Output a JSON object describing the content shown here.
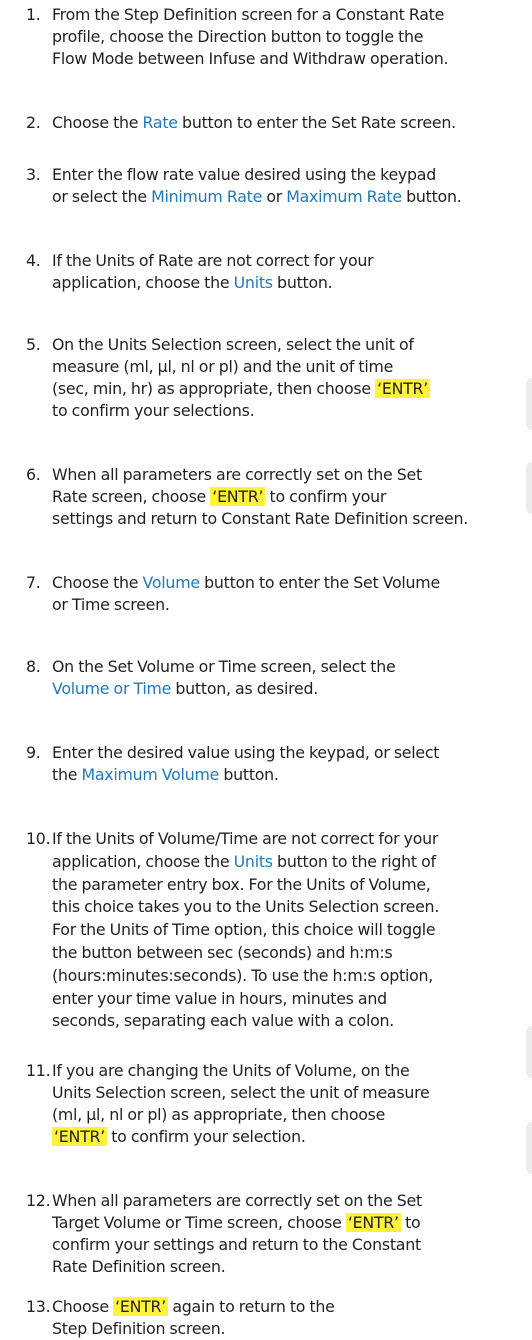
{
  "steps": [
    {
      "n": "1.",
      "lines": [
        [
          [
            "From the Step Definition screen for a Constant Rate",
            ""
          ]
        ],
        [
          [
            "profile, choose the Direction button to toggle the",
            ""
          ]
        ],
        [
          [
            "Flow Mode between Infuse and Withdraw operation.",
            ""
          ]
        ]
      ]
    },
    {
      "n": "2.",
      "lines": [
        [
          [
            "Choose the ",
            ""
          ],
          [
            "Rate",
            "blue"
          ],
          [
            " button to enter the Set Rate screen.",
            ""
          ]
        ]
      ]
    },
    {
      "n": "3.",
      "lines": [
        [
          [
            "Enter the flow rate value desired using the keypad",
            ""
          ]
        ],
        [
          [
            "or select the ",
            ""
          ],
          [
            "Minimum Rate",
            "blue"
          ],
          [
            " or ",
            ""
          ],
          [
            "Maximum Rate",
            "blue"
          ],
          [
            " button.",
            ""
          ]
        ]
      ]
    },
    {
      "n": "4.",
      "lines": [
        [
          [
            "If the Units of Rate are not correct for your",
            ""
          ]
        ],
        [
          [
            "application, choose the ",
            ""
          ],
          [
            "Units",
            "blue"
          ],
          [
            " button.",
            ""
          ]
        ]
      ]
    },
    {
      "n": "5.",
      "lines": [
        [
          [
            "On the Units Selection screen, select the unit of",
            ""
          ]
        ],
        [
          [
            "measure (ml, µl, nl or pl) and the unit of time",
            ""
          ]
        ],
        [
          [
            "(sec, min, hr) as appropriate, then choose ",
            ""
          ],
          [
            "‘ENTR’",
            "key"
          ]
        ],
        [
          [
            "to confirm your selections.",
            ""
          ]
        ]
      ]
    },
    {
      "n": "6.",
      "lines": [
        [
          [
            "When all parameters are correctly set on the Set",
            ""
          ]
        ],
        [
          [
            "Rate screen, choose ",
            ""
          ],
          [
            "‘ENTR’",
            "key"
          ],
          [
            " to confirm your",
            ""
          ]
        ],
        [
          [
            "settings and return to Constant Rate Definition screen.",
            ""
          ]
        ]
      ]
    },
    {
      "n": "7.",
      "lines": [
        [
          [
            "Choose the ",
            ""
          ],
          [
            "Volume",
            "blue"
          ],
          [
            " button to enter the Set Volume",
            ""
          ]
        ],
        [
          [
            "or Time screen.",
            ""
          ]
        ]
      ]
    },
    {
      "n": "8.",
      "lines": [
        [
          [
            "On the Set Volume or Time screen, select the",
            ""
          ]
        ],
        [
          [
            "Volume or Time",
            "blue"
          ],
          [
            " button, as desired.",
            ""
          ]
        ]
      ]
    },
    {
      "n": "9.",
      "lines": [
        [
          [
            "Enter the desired value using the keypad, or select",
            ""
          ]
        ],
        [
          [
            "the ",
            ""
          ],
          [
            "Maximum Volume",
            "blue"
          ],
          [
            " button.",
            ""
          ]
        ]
      ]
    },
    {
      "n": "10.",
      "lines": [
        [
          [
            "If the Units of Volume/Time are not correct for your",
            ""
          ]
        ],
        [
          [
            "application, choose the ",
            ""
          ],
          [
            "Units",
            "blue"
          ],
          [
            " button to the right of",
            ""
          ]
        ],
        [
          [
            "the parameter entry box. For the Units of Volume,",
            ""
          ]
        ],
        [
          [
            "this choice takes you to the Units Selection screen.",
            ""
          ]
        ],
        [
          [
            "For the Units of Time option, this choice will toggle",
            ""
          ]
        ],
        [
          [
            "the button between sec (seconds) and h:m:s",
            ""
          ]
        ],
        [
          [
            "(hours:minutes:seconds). To use the h:m:s option,",
            ""
          ]
        ],
        [
          [
            "enter your time value in hours, minutes and",
            ""
          ]
        ],
        [
          [
            "seconds, separating each value with a colon.",
            ""
          ]
        ]
      ]
    },
    {
      "n": "11.",
      "lines": [
        [
          [
            "If you are changing the Units of Volume, on the",
            ""
          ]
        ],
        [
          [
            "Units Selection screen, select the unit of measure",
            ""
          ]
        ],
        [
          [
            "(ml, µl, nl or pl) as appropriate, then choose",
            ""
          ]
        ],
        [
          [
            "‘ENTR’",
            "key"
          ],
          [
            " to confirm your selection.",
            ""
          ]
        ]
      ]
    },
    {
      "n": "12.",
      "lines": [
        [
          [
            "When all parameters are correctly set on the Set",
            ""
          ]
        ],
        [
          [
            "Target Volume or Time screen, choose ",
            ""
          ],
          [
            "‘ENTR’",
            "key"
          ],
          [
            " to",
            ""
          ]
        ],
        [
          [
            "confirm your settings and return to the Constant",
            ""
          ]
        ],
        [
          [
            "Rate Definition screen.",
            ""
          ]
        ]
      ]
    },
    {
      "n": "13.",
      "lines": [
        [
          [
            "Choose ",
            ""
          ],
          [
            "‘ENTR’",
            "key"
          ],
          [
            " again to return to the",
            ""
          ]
        ],
        [
          [
            "Step Definition screen.",
            ""
          ]
        ]
      ]
    }
  ]
}
